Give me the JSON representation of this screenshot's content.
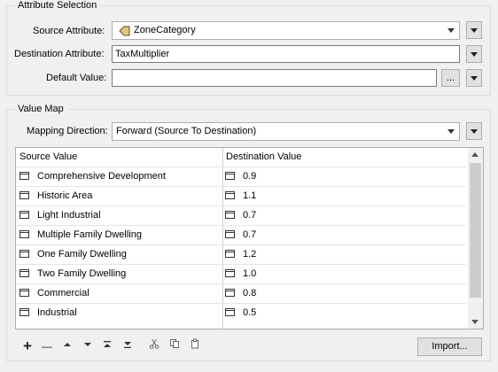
{
  "attribute_selection": {
    "title": "Attribute Selection",
    "source_label": "Source Attribute:",
    "source_value": "ZoneCategory",
    "destination_label": "Destination Attribute:",
    "destination_value": "TaxMultiplier",
    "default_label": "Default Value:",
    "default_value": "",
    "ellipsis": "..."
  },
  "value_map": {
    "title": "Value Map",
    "direction_label": "Mapping Direction:",
    "direction_value": "Forward (Source To Destination)",
    "columns": [
      "Source Value",
      "Destination Value"
    ],
    "rows": [
      {
        "source": "Comprehensive Development",
        "dest": "0.9"
      },
      {
        "source": "Historic Area",
        "dest": "1.1"
      },
      {
        "source": "Light Industrial",
        "dest": "0.7"
      },
      {
        "source": "Multiple Family Dwelling",
        "dest": "0.7"
      },
      {
        "source": "One Family Dwelling",
        "dest": "1.2"
      },
      {
        "source": "Two Family Dwelling",
        "dest": "1.0"
      },
      {
        "source": "Commercial",
        "dest": "0.8"
      },
      {
        "source": "Industrial",
        "dest": "0.5"
      }
    ]
  },
  "toolbar": {
    "add": "+",
    "remove": "—",
    "import_label": "Import..."
  }
}
